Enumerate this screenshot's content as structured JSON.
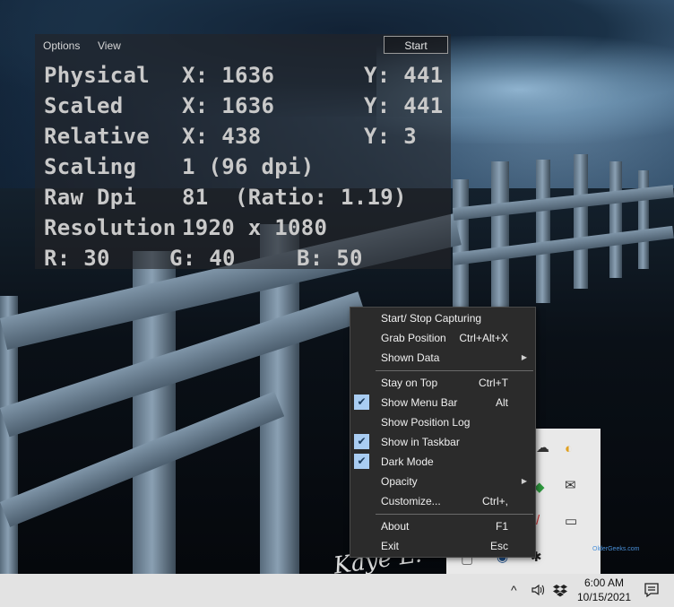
{
  "app": {
    "menu": {
      "options": "Options",
      "view": "View"
    },
    "start_label": "Start",
    "rows": [
      {
        "label": "Physical",
        "x": "X: 1636",
        "y": "Y: 441"
      },
      {
        "label": "Scaled",
        "x": "X: 1636",
        "y": "Y: 441"
      },
      {
        "label": "Relative",
        "x": "X: 438",
        "y": "Y: 3"
      },
      {
        "label": "Scaling",
        "value": "1 (96 dpi)"
      },
      {
        "label": "Raw Dpi",
        "value": "81  (Ratio: 1.19)"
      },
      {
        "label": "Resolution",
        "value": "1920 x 1080"
      }
    ],
    "rgb": {
      "r": "R: 30",
      "g": "G: 40",
      "b": "B: 50"
    }
  },
  "context_menu": {
    "items": [
      {
        "label": "Start/ Stop Capturing",
        "shortcut": "",
        "checked": false,
        "submenu": false
      },
      {
        "label": "Grab Position",
        "shortcut": "Ctrl+Alt+X",
        "checked": false,
        "submenu": false
      },
      {
        "label": "Shown Data",
        "shortcut": "",
        "checked": false,
        "submenu": true
      },
      {
        "label": "Stay on Top",
        "shortcut": "Ctrl+T",
        "checked": false,
        "submenu": false
      },
      {
        "label": "Show Menu Bar",
        "shortcut": "Alt",
        "checked": true,
        "submenu": false
      },
      {
        "label": "Show Position Log",
        "shortcut": "",
        "checked": false,
        "submenu": false
      },
      {
        "label": "Show in Taskbar",
        "shortcut": "",
        "checked": true,
        "submenu": false
      },
      {
        "label": "Dark Mode",
        "shortcut": "",
        "checked": true,
        "submenu": false
      },
      {
        "label": "Opacity",
        "shortcut": "",
        "checked": false,
        "submenu": true
      },
      {
        "label": "Customize...",
        "shortcut": "Ctrl+,",
        "checked": false,
        "submenu": false
      },
      {
        "label": "About",
        "shortcut": "F1",
        "checked": false,
        "submenu": false
      },
      {
        "label": "Exit",
        "shortcut": "Esc",
        "checked": false,
        "submenu": false
      }
    ],
    "check_glyph": "✔",
    "submenu_glyph": "▶"
  },
  "tray_flyout": {
    "watermark": "OlderGeeks.com"
  },
  "taskbar": {
    "icons": [
      "chevron-up-icon",
      "speaker-icon",
      "dropbox-icon",
      "notification-icon"
    ],
    "time": "6:00 AM",
    "date": "10/15/2021"
  },
  "desktop": {
    "signature": "Kaye L."
  }
}
